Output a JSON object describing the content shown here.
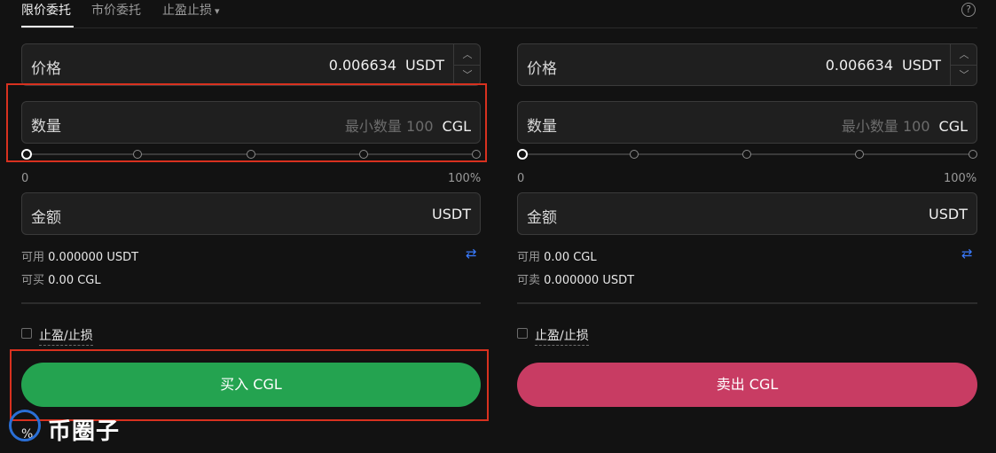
{
  "tabs": {
    "limit": "限价委托",
    "market": "市价委托",
    "tpsl": "止盈止损",
    "help": "?"
  },
  "buy": {
    "price_label": "价格",
    "price_value": "0.006634",
    "price_unit": "USDT",
    "qty_label": "数量",
    "qty_placeholder": "最小数量 100",
    "qty_unit": "CGL",
    "slider_min": "0",
    "slider_max": "100%",
    "amount_label": "金额",
    "amount_unit": "USDT",
    "avail_label": "可用",
    "avail_value": "0.000000 USDT",
    "can_label": "可买",
    "can_value": "0.00 CGL",
    "tpsl_label": "止盈/止损",
    "button": "买入 CGL"
  },
  "sell": {
    "price_label": "价格",
    "price_value": "0.006634",
    "price_unit": "USDT",
    "qty_label": "数量",
    "qty_placeholder": "最小数量 100",
    "qty_unit": "CGL",
    "slider_min": "0",
    "slider_max": "100%",
    "amount_label": "金额",
    "amount_unit": "USDT",
    "avail_label": "可用",
    "avail_value": "0.00 CGL",
    "can_label": "可卖",
    "can_value": "0.000000 USDT",
    "tpsl_label": "止盈/止损",
    "button": "卖出 CGL"
  },
  "icons": {
    "chevron": "chevron-down-icon",
    "up": "caret-up-icon",
    "down": "caret-down-icon",
    "swap": "swap-icon",
    "help": "help-circle-icon"
  },
  "colors": {
    "buy": "#24a350",
    "sell": "#c83c63",
    "highlight": "#d8311f",
    "link": "#3a7bff"
  },
  "watermark": {
    "text": "币圈子",
    "fee_prefix": "%"
  }
}
